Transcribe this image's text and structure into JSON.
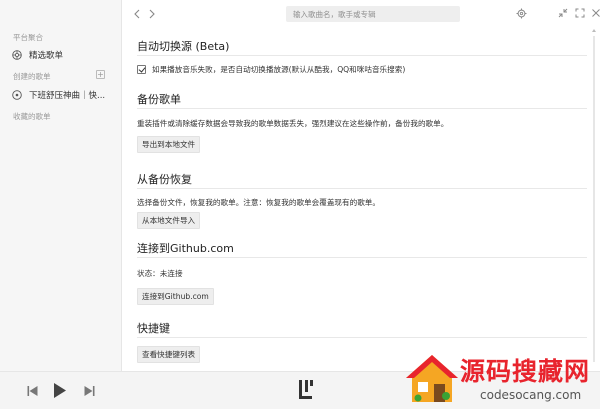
{
  "sidebar": {
    "section_platform": "平台聚合",
    "featured_label": "精选歌单",
    "section_created": "创建的歌单",
    "add_symbol": "+",
    "created_item_label": "下班舒压神曲｜快...",
    "section_collected": "收藏的歌单"
  },
  "topbar": {
    "search_placeholder": "输入歌曲名，歌手或专辑"
  },
  "settings": {
    "auto_switch": {
      "title": "自动切换源 (Beta)",
      "checkbox_label": "如果播放音乐失败，是否自动切换播放源(默认从酷我，QQ和咪咕音乐搜索)",
      "checked": true
    },
    "backup": {
      "title": "备份歌单",
      "desc": "重装插件或清除缓存数据会导致我的歌单数据丢失，强烈建议在这些操作前，备份我的歌单。",
      "button": "导出到本地文件"
    },
    "restore": {
      "title": "从备份恢复",
      "desc": "选择备份文件，恢复我的歌单。注意：恢复我的歌单会覆盖现有的歌单。",
      "button": "从本地文件导入"
    },
    "github": {
      "title": "连接到Github.com",
      "status": "状态：未连接",
      "button": "连接到Github.com"
    },
    "shortcuts": {
      "title": "快捷键",
      "button": "查看快捷键列表"
    }
  },
  "watermark": {
    "title": "源码搜藏网",
    "url": "codesocang.com"
  },
  "colors": {
    "watermark_red": "#e8242d",
    "sidebar_bg": "#f6f6f6",
    "button_bg": "#eeeeee"
  },
  "icons": {
    "back": "chevron-left-icon",
    "forward": "chevron-right-icon",
    "settings": "gear-icon",
    "minimize": "minimize-icon",
    "fullscreen": "fullscreen-icon",
    "close": "close-icon",
    "featured": "aperture-icon",
    "playlist": "disc-icon",
    "prev": "skip-previous-icon",
    "play": "play-icon",
    "next": "skip-next-icon",
    "logo": "app-logo-icon"
  }
}
